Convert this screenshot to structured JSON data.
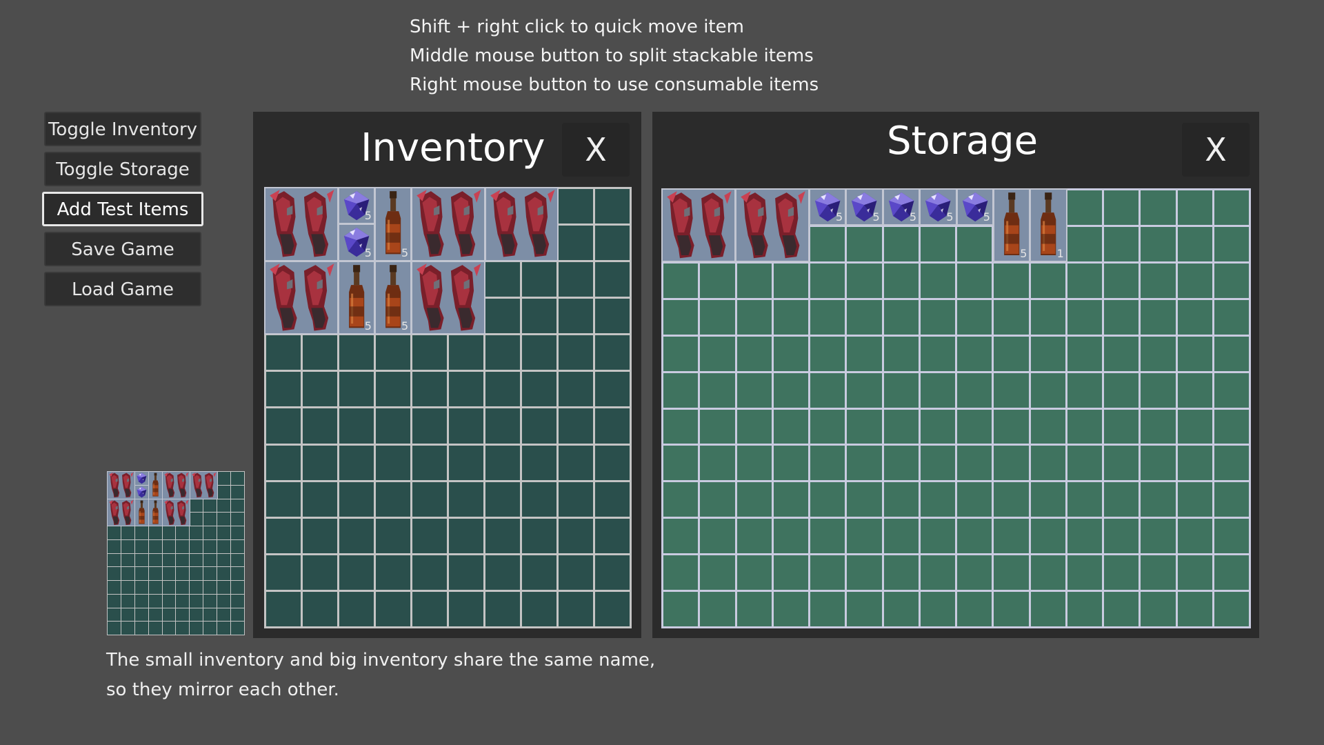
{
  "hints": [
    "Shift + right click to quick move item",
    "Middle mouse button to split stackable items",
    "Right mouse button to use consumable items"
  ],
  "menu": {
    "buttons": [
      {
        "label": "Toggle Inventory",
        "name": "toggle-inventory-button"
      },
      {
        "label": "Toggle Storage",
        "name": "toggle-storage-button"
      },
      {
        "label": "Add Test Items",
        "name": "add-test-items-button",
        "focused": true
      },
      {
        "label": "Save Game",
        "name": "save-game-button"
      },
      {
        "label": "Load Game",
        "name": "load-game-button"
      }
    ]
  },
  "inventory": {
    "title": "Inventory",
    "close_label": "X",
    "cols": 10,
    "rows": 12,
    "cell_color": "#2a4f4c",
    "line_color": "#c4c4c4",
    "items": [
      {
        "type": "boots",
        "col": 0,
        "row": 0,
        "w": 2,
        "h": 2
      },
      {
        "type": "gem",
        "col": 2,
        "row": 0,
        "w": 1,
        "h": 1,
        "count": "5"
      },
      {
        "type": "gem",
        "col": 2,
        "row": 1,
        "w": 1,
        "h": 1,
        "count": "5"
      },
      {
        "type": "potion",
        "col": 3,
        "row": 0,
        "w": 1,
        "h": 2,
        "count": "5"
      },
      {
        "type": "boots",
        "col": 4,
        "row": 0,
        "w": 2,
        "h": 2
      },
      {
        "type": "boots",
        "col": 6,
        "row": 0,
        "w": 2,
        "h": 2
      },
      {
        "type": "boots",
        "col": 0,
        "row": 2,
        "w": 2,
        "h": 2
      },
      {
        "type": "potion",
        "col": 2,
        "row": 2,
        "w": 1,
        "h": 2,
        "count": "5"
      },
      {
        "type": "potion",
        "col": 3,
        "row": 2,
        "w": 1,
        "h": 2,
        "count": "5"
      },
      {
        "type": "boots",
        "col": 4,
        "row": 2,
        "w": 2,
        "h": 2
      }
    ]
  },
  "storage": {
    "title": "Storage",
    "close_label": "X",
    "cols": 16,
    "rows": 12,
    "cell_color": "#3f735f",
    "line_color": "#c9cbe0",
    "items": [
      {
        "type": "boots",
        "col": 0,
        "row": 0,
        "w": 2,
        "h": 2
      },
      {
        "type": "boots",
        "col": 2,
        "row": 0,
        "w": 2,
        "h": 2
      },
      {
        "type": "gem",
        "col": 4,
        "row": 0,
        "w": 1,
        "h": 1,
        "count": "5"
      },
      {
        "type": "gem",
        "col": 5,
        "row": 0,
        "w": 1,
        "h": 1,
        "count": "5"
      },
      {
        "type": "gem",
        "col": 6,
        "row": 0,
        "w": 1,
        "h": 1,
        "count": "5"
      },
      {
        "type": "gem",
        "col": 7,
        "row": 0,
        "w": 1,
        "h": 1,
        "count": "5"
      },
      {
        "type": "gem",
        "col": 8,
        "row": 0,
        "w": 1,
        "h": 1,
        "count": "5"
      },
      {
        "type": "potion",
        "col": 9,
        "row": 0,
        "w": 1,
        "h": 2,
        "count": "5"
      },
      {
        "type": "potion",
        "col": 10,
        "row": 0,
        "w": 1,
        "h": 2,
        "count": "1"
      }
    ]
  },
  "mini_inventory": {
    "cols": 10,
    "rows": 12,
    "cell_color": "#2a4f4c",
    "line_color": "#c4c4c4"
  },
  "bottom_text": [
    "The small inventory and big inventory share the same name,",
    "so they mirror each other."
  ]
}
